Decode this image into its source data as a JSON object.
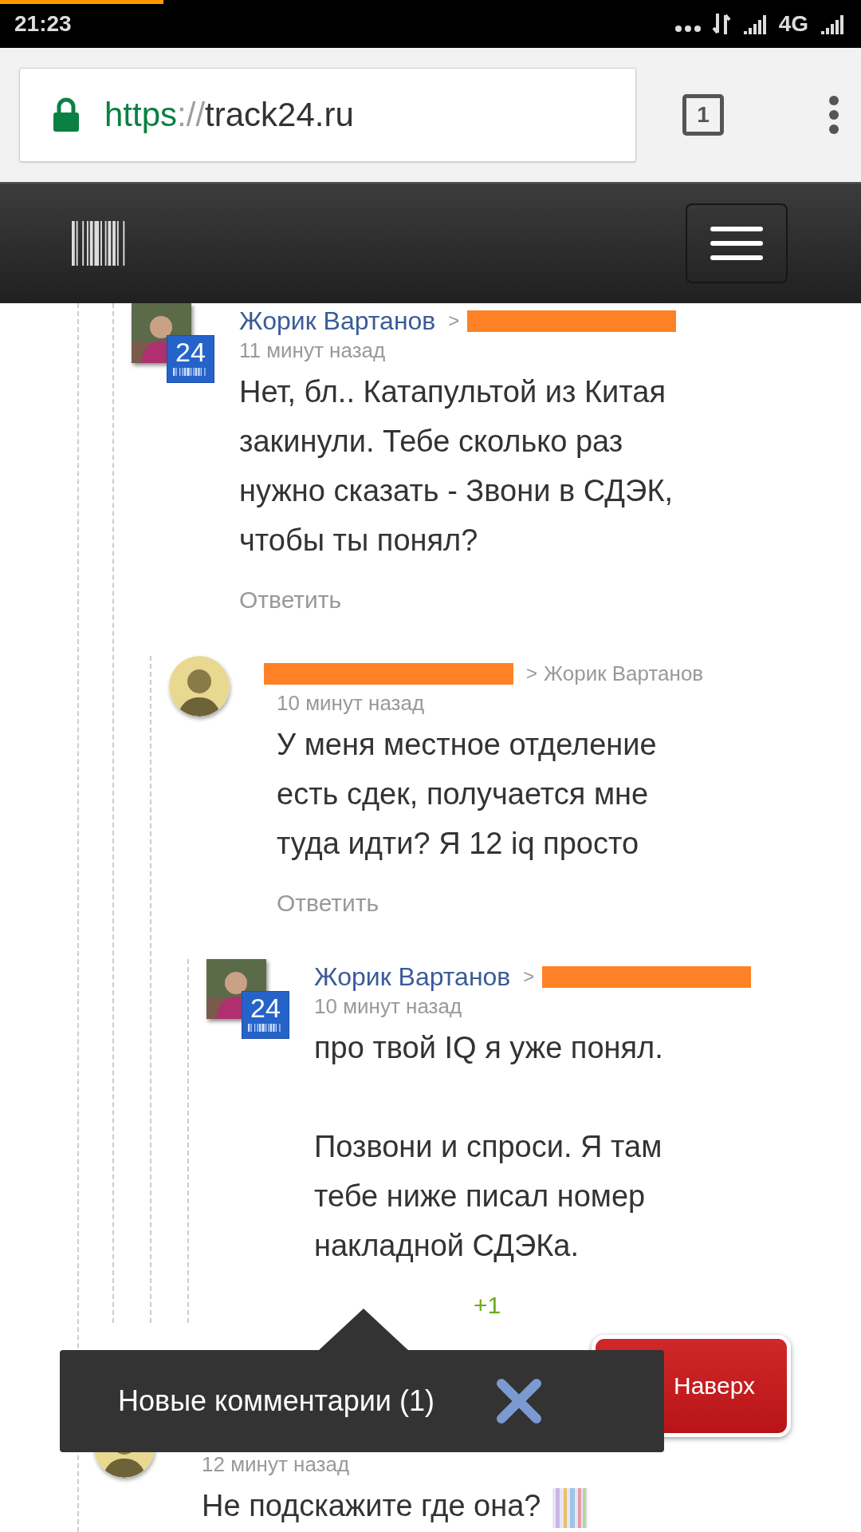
{
  "status_bar": {
    "time": "21:23",
    "network_type": "4G"
  },
  "browser": {
    "load_progress": {
      "level": 0.19
    },
    "url": {
      "scheme": "https",
      "separator": "://",
      "host": "track24.ru"
    },
    "tab_count": "1"
  },
  "comments": [
    {
      "replies": [
        {
          "author": "Жорик Вартанов",
          "author_redacted": false,
          "avatar": {
            "kind": "square"
          },
          "badge": "24",
          "reply_to": {
            "prefix": ">",
            "redacted": true
          },
          "time": "11 минут назад",
          "paragraphs": [
            "Нет, бл.. Катапультой из Китая закинули. Тебе сколько раз нужно сказать - Звони в СДЭК, чтобы ты понял?"
          ],
          "reply": "Ответить",
          "replies": [
            {
              "author_redacted": true,
              "avatar": {
                "kind": "round"
              },
              "reply_to": {
                "prefix": ">",
                "name": "Жорик Вартанов",
                "redacted": false
              },
              "time": "10 минут назад",
              "paragraphs": [
                "У меня местное отделение есть сдек, получается мне туда идти? Я 12 iq просто"
              ],
              "reply": "Ответить",
              "replies": [
                {
                  "author": "Жорик Вартанов",
                  "author_redacted": false,
                  "avatar": {
                    "kind": "square"
                  },
                  "badge": "24",
                  "reply_to": {
                    "prefix": ">",
                    "redacted": true
                  },
                  "time": "10 минут назад",
                  "paragraphs": [
                    "про твой IQ я уже понял.",
                    "Позвони и спроси. Я там тебе ниже писал номер накладной СДЭКа."
                  ],
                  "votes": "+1"
                }
              ]
            }
          ]
        }
      ]
    },
    {
      "avatar": {
        "kind": "round"
      },
      "time": "12 минут назад",
      "paragraphs": [
        "Не подскажите где она?"
      ],
      "attachment": {
        "kind": "picture"
      }
    }
  ],
  "to_top": {
    "label": "Наверх"
  },
  "popup": {
    "text": "Новые комментарии (1)"
  }
}
